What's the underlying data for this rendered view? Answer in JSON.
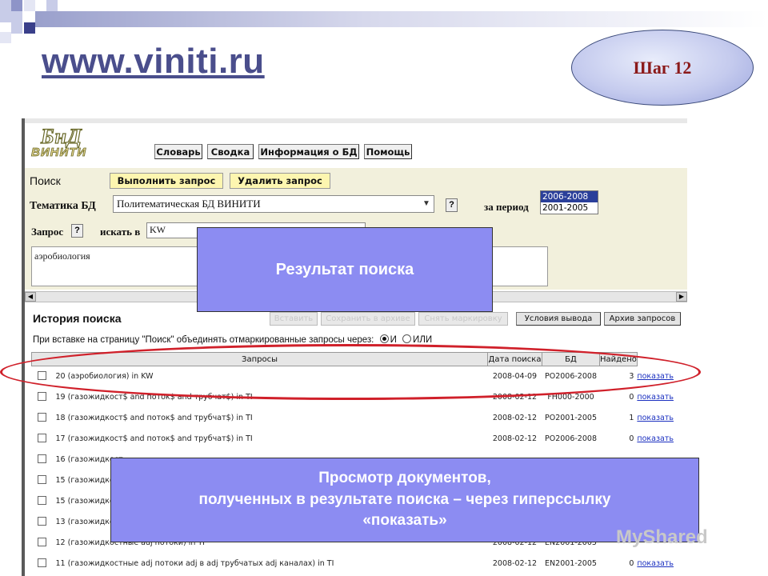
{
  "slide": {
    "title": "www.viniti.ru",
    "step_label": "Шаг 12",
    "colors": {
      "title": "#4a4e8c",
      "step_text": "#8b1a1a",
      "callout_bg": "#8c8cf2",
      "highlight_ellipse": "#d0202a"
    }
  },
  "app": {
    "logo_top": "БнД",
    "logo_bottom": "ВИНИТИ",
    "menu": [
      "Словарь",
      "Сводка",
      "Информация о БД",
      "Помощь"
    ],
    "search": {
      "heading": "Поиск",
      "run_button": "Выполнить запрос",
      "delete_button": "Удалить запрос",
      "db_label": "Тематика БД",
      "db_value": "Политематическая БД ВИНИТИ",
      "help_icon_label": "?",
      "period_label": "за период",
      "period_options": [
        "2006-2008",
        "2001-2005"
      ],
      "query_label": "Запрос",
      "search_in_label": "искать в",
      "search_in_value": "KW",
      "query_text": "аэробиология"
    },
    "history": {
      "title": "История поиска",
      "buttons": [
        "Вставить",
        "Сохранить в архиве",
        "Снять маркировку",
        "Условия вывода",
        "Архив запросов"
      ],
      "merge_text": "При вставке на страницу \"Поиск\" объединять отмаркированные запросы через:",
      "radio_and": "И",
      "radio_or": "ИЛИ",
      "columns": [
        "Запросы",
        "Дата поиска",
        "БД",
        "Найдено"
      ],
      "rows": [
        {
          "query": "20 (аэробиология) in KW",
          "date": "2008-04-09",
          "db": "PO2006-2008",
          "found": "3",
          "link": "показать"
        },
        {
          "query": "19 (газожидкост$ and поток$ and трубчат$) in TI",
          "date": "2008-02-12",
          "db": "FH000-2000",
          "found": "0",
          "link": "показать"
        },
        {
          "query": "18 (газожидкост$ and поток$ and трубчат$) in TI",
          "date": "2008-02-12",
          "db": "PO2001-2005",
          "found": "1",
          "link": "показать"
        },
        {
          "query": "17 (газожидкост$ and поток$ and трубчат$) in TI",
          "date": "2008-02-12",
          "db": "PO2006-2008",
          "found": "0",
          "link": "показать"
        },
        {
          "query": "16 (газожидкост",
          "date": "",
          "db": "",
          "found": "",
          "link": ""
        },
        {
          "query": "15 (газожидкост",
          "date": "",
          "db": "",
          "found": "",
          "link": ""
        },
        {
          "query": "15 (газожидкост",
          "date": "",
          "db": "",
          "found": "",
          "link": ""
        },
        {
          "query": "13 (газожидкост",
          "date": "",
          "db": "",
          "found": "",
          "link": ""
        },
        {
          "query": "12 (газожидкостные adj потоки) in TI",
          "date": "2008-02-12",
          "db": "EN2001-2005",
          "found": "",
          "link": ""
        },
        {
          "query": "11 (газожидкостные adj потоки adj в adj трубчатых adj каналах) in TI",
          "date": "2008-02-12",
          "db": "EN2001-2005",
          "found": "0",
          "link": "показать"
        }
      ]
    }
  },
  "callouts": {
    "result_label": "Результат поиска",
    "note_line1": "Просмотр документов,",
    "note_line2": "полученных в результате поиска – через гиперссылку",
    "note_line3": "«показать»"
  },
  "watermark": "MyShared"
}
